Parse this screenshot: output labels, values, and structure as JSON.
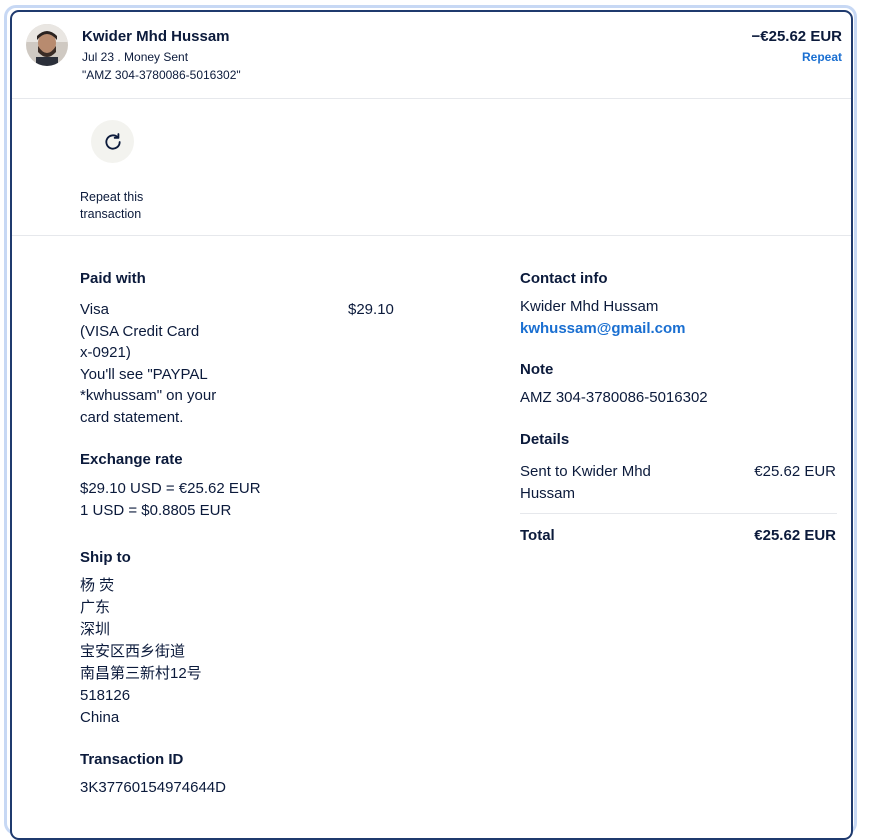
{
  "header": {
    "name": "Kwider Mhd Hussam",
    "date_type": "Jul 23 . Money Sent",
    "reference": "\"AMZ 304-3780086-5016302\"",
    "amount": "−€25.62 EUR",
    "repeat_link": "Repeat"
  },
  "actions": {
    "repeat_line1": "Repeat this",
    "repeat_line2": "transaction"
  },
  "paid_with": {
    "title": "Paid with",
    "lines": [
      "Visa",
      "(VISA Credit Card",
      "x-0921)",
      "You'll see \"PAYPAL",
      "*kwhussam\" on your",
      "card statement."
    ],
    "amount": "$29.10"
  },
  "exchange_rate": {
    "title": "Exchange rate",
    "line1": "$29.10 USD = €25.62 EUR",
    "line2": "1 USD = $0.8805 EUR"
  },
  "ship_to": {
    "title": "Ship to",
    "lines": [
      "杨 荧",
      "广东",
      "深圳",
      "宝安区西乡街道",
      "南昌第三新村12号",
      "518126",
      "China"
    ]
  },
  "transaction": {
    "title": "Transaction ID",
    "id": "3K37760154974644D"
  },
  "contact": {
    "title": "Contact info",
    "name": "Kwider Mhd Hussam",
    "email": "kwhussam@gmail.com"
  },
  "note": {
    "title": "Note",
    "text": "AMZ 304-3780086-5016302"
  },
  "details": {
    "title": "Details",
    "line1": "Sent to Kwider Mhd",
    "line2": "Hussam",
    "amount": "€25.62 EUR",
    "total_label": "Total",
    "total_amount": "€25.62 EUR"
  },
  "colors": {
    "text": "#0b1a3b",
    "link": "#1a6fd1",
    "card_border": "#1f3a6e",
    "outer_border": "#c7d8f4"
  }
}
